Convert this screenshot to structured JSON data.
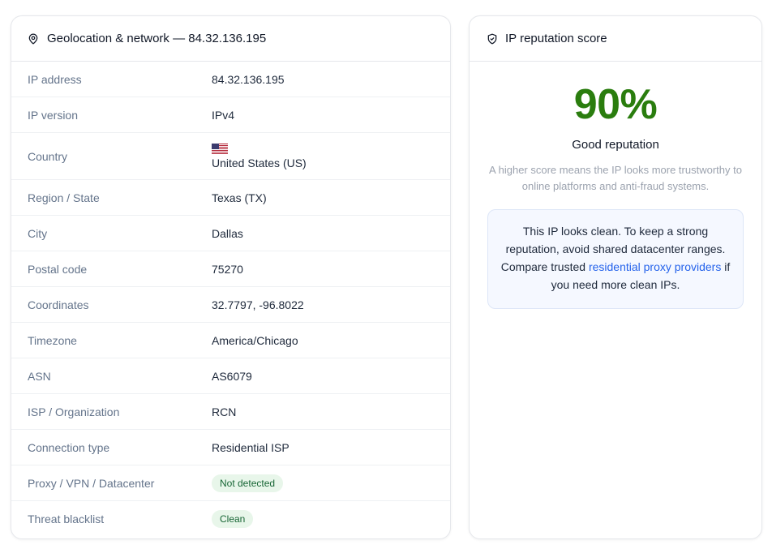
{
  "geo": {
    "title": "Geolocation & network — 84.32.136.195",
    "header_icon": "map-pin-icon",
    "rows": [
      {
        "label": "IP address",
        "value": "84.32.136.195"
      },
      {
        "label": "IP version",
        "value": "IPv4"
      },
      {
        "label": "Country",
        "value": "United States (US)",
        "flag_icon": "us-flag-icon"
      },
      {
        "label": "Region / State",
        "value": "Texas (TX)"
      },
      {
        "label": "City",
        "value": "Dallas"
      },
      {
        "label": "Postal code",
        "value": "75270"
      },
      {
        "label": "Coordinates",
        "value": "32.7797, -96.8022"
      },
      {
        "label": "Timezone",
        "value": "America/Chicago"
      },
      {
        "label": "ASN",
        "value": "AS6079"
      },
      {
        "label": "ISP / Organization",
        "value": "RCN"
      },
      {
        "label": "Connection type",
        "value": "Residential ISP"
      },
      {
        "label": "Proxy / VPN / Datacenter",
        "value": "Not detected",
        "badge": true
      },
      {
        "label": "Threat blacklist",
        "value": "Clean",
        "badge": true
      }
    ]
  },
  "reputation": {
    "title": "IP reputation score",
    "header_icon": "shield-check-icon",
    "score": "90%",
    "score_label": "Good reputation",
    "description": "A higher score means the IP looks more trustworthy to online platforms and anti-fraud systems.",
    "note_before": "This IP looks clean. To keep a strong reputation, avoid shared datacenter ranges. Compare trusted ",
    "note_link": "residential proxy providers",
    "note_after": " if you need more clean IPs."
  },
  "colors": {
    "score_green": "#2a7d0e",
    "badge_bg": "#e8f6ea",
    "badge_text": "#166534",
    "link_blue": "#2563eb",
    "note_bg": "#f5f8ff"
  }
}
